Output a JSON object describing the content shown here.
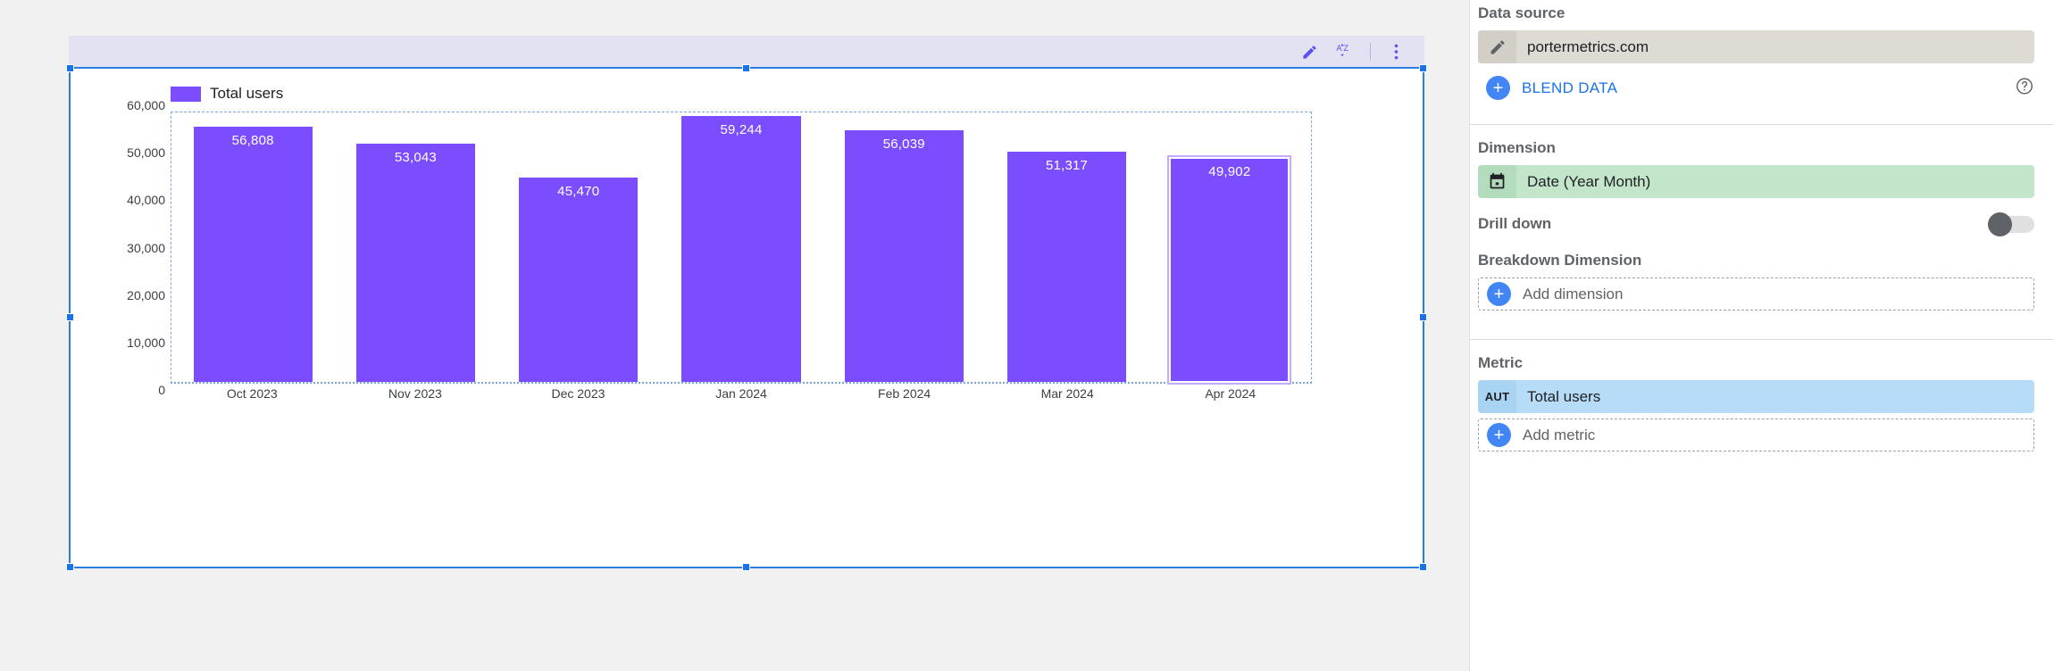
{
  "chart_toolbar": {
    "edit_icon": "pencil-icon",
    "sort_icon": "sort-az-icon",
    "more_icon": "more-vertical-icon"
  },
  "chart_data": {
    "type": "bar",
    "title": "",
    "xlabel": "",
    "ylabel": "",
    "legend": [
      {
        "name": "Total users",
        "color": "#7c4dff"
      }
    ],
    "legend_position": "top-left",
    "grid": false,
    "categories": [
      "Oct 2023",
      "Nov 2023",
      "Dec 2023",
      "Jan 2024",
      "Feb 2024",
      "Mar 2024",
      "Apr 2024"
    ],
    "series": [
      {
        "name": "Total users",
        "color": "#7c4dff",
        "values": [
          56808,
          53043,
          45470,
          59244,
          56039,
          51317,
          49902
        ],
        "value_labels": [
          "56,808",
          "53,043",
          "45,470",
          "59,244",
          "56,039",
          "51,317",
          "49,902"
        ]
      }
    ],
    "selected_category": "Apr 2024",
    "ylim": [
      0,
      60000
    ],
    "y_ticks": [
      0,
      10000,
      20000,
      30000,
      40000,
      50000,
      60000
    ],
    "y_tick_labels": [
      "0",
      "10,000",
      "20,000",
      "30,000",
      "40,000",
      "50,000",
      "60,000"
    ]
  },
  "panel": {
    "data_source": {
      "title": "Data source",
      "value": "portermetrics.com",
      "icon": "pencil-icon",
      "blend_label": "BLEND DATA",
      "blend_icon": "plus-icon",
      "help_icon": "help-circle-icon"
    },
    "dimension": {
      "title": "Dimension",
      "value": "Date (Year Month)",
      "icon": "calendar-icon"
    },
    "drill_down": {
      "label": "Drill down",
      "state": "off"
    },
    "breakdown_dimension": {
      "title": "Breakdown Dimension",
      "add_label": "Add dimension",
      "add_icon": "plus-icon"
    },
    "metric": {
      "title": "Metric",
      "badge": "AUT",
      "value": "Total users",
      "add_label": "Add metric",
      "add_icon": "plus-icon"
    }
  },
  "colors": {
    "bar": "#7c4dff",
    "selection": "#2a7de1",
    "accent_blue": "#1a73e8",
    "toolbar_bg": "#e3e2f3"
  }
}
